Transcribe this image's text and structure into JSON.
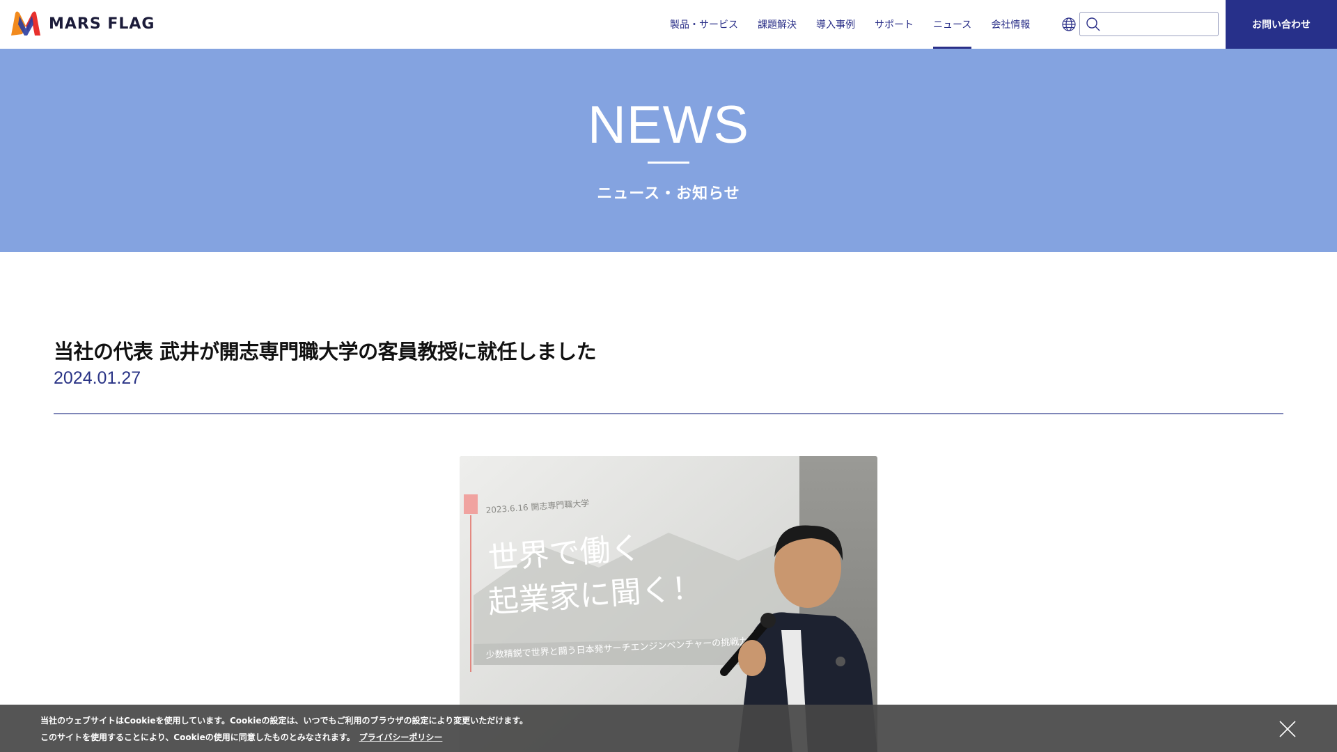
{
  "brand": {
    "name": "MARS FLAG"
  },
  "nav": {
    "items": [
      {
        "label": "製品・サービス",
        "active": false
      },
      {
        "label": "課題解決",
        "active": false
      },
      {
        "label": "導入事例",
        "active": false
      },
      {
        "label": "サポート",
        "active": false
      },
      {
        "label": "ニュース",
        "active": true
      },
      {
        "label": "会社情報",
        "active": false
      }
    ],
    "globe_icon": "globe-icon",
    "search": {
      "placeholder": "",
      "value": "",
      "icon": "search-icon"
    },
    "contact_label": "お問い合わせ"
  },
  "hero": {
    "title": "NEWS",
    "subtitle": "ニュース・お知らせ"
  },
  "article": {
    "title": "当社の代表 武井が開志専門職大学の客員教授に就任しました",
    "date": "2024.01.27"
  },
  "photo": {
    "slide_date": "2023.6.16 開志専門職大学",
    "slide_line1": "世界で働く",
    "slide_line2": "起業家に聞く！",
    "slide_sub": "少数精鋭で世界と闘う日本発サーチエンジンベンチャーの挑戦力"
  },
  "cookie": {
    "line1": "当社のウェブサイトはCookieを使用しています。Cookieの設定は、いつでもご利用のブラウザの設定により変更いただけます。",
    "line2": "このサイトを使用することにより、Cookieの使用に同意したものとみなされます。",
    "link_label": "プライバシーポリシー",
    "close_icon": "close-icon"
  },
  "colors": {
    "brand_navy": "#27308a",
    "hero_blue": "#84a3e0",
    "nav_text": "#2a2f88"
  }
}
